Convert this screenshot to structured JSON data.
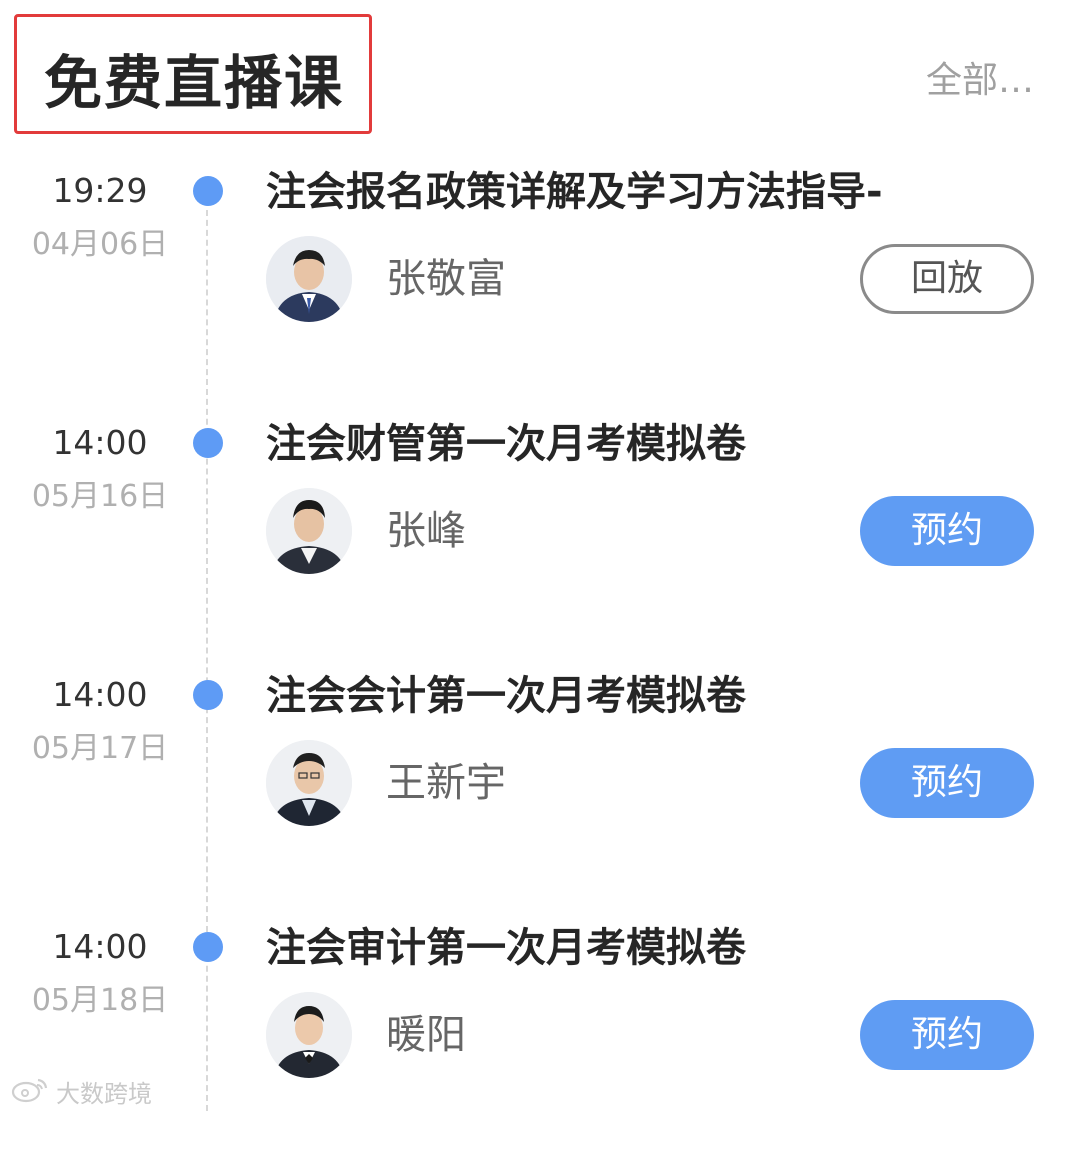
{
  "header": {
    "title": "免费直播课",
    "see_all": "全部…"
  },
  "colors": {
    "accent": "#5f9cf3",
    "highlight_box": "#e23b3b",
    "timeline_dot": "#5e9bf5"
  },
  "courses": [
    {
      "time": "19:29",
      "date": "04月06日",
      "title": "注会报名政策详解及学习方法指导-",
      "teacher": "张敬富",
      "action": "回放",
      "action_type": "replay"
    },
    {
      "time": "14:00",
      "date": "05月16日",
      "title": "注会财管第一次月考模拟卷",
      "teacher": "张峰",
      "action": "预约",
      "action_type": "reserve"
    },
    {
      "time": "14:00",
      "date": "05月17日",
      "title": "注会会计第一次月考模拟卷",
      "teacher": "王新宇",
      "action": "预约",
      "action_type": "reserve"
    },
    {
      "time": "14:00",
      "date": "05月18日",
      "title": "注会审计第一次月考模拟卷",
      "teacher": "暖阳",
      "action": "预约",
      "action_type": "reserve"
    }
  ],
  "watermark": {
    "icon": "weibo-logo-icon",
    "text": "大数跨境"
  }
}
